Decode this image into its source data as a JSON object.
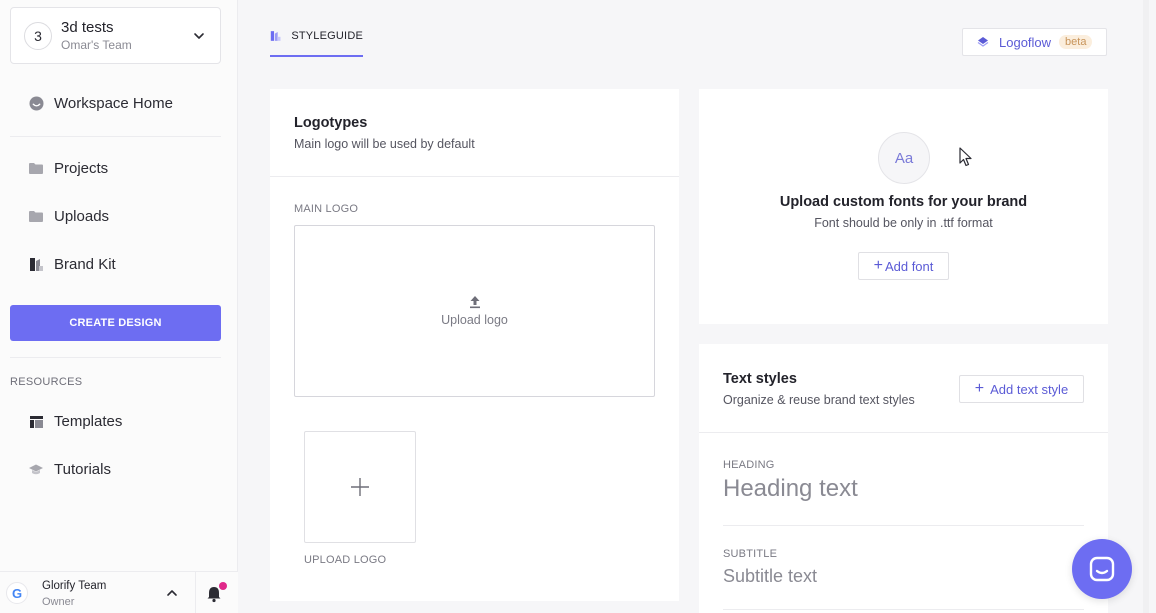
{
  "sidebar": {
    "team": {
      "avatar_letter": "3",
      "name": "3d tests",
      "subtitle": "Omar's Team"
    },
    "nav": {
      "workspace_home": "Workspace Home",
      "projects": "Projects",
      "uploads": "Uploads",
      "brand_kit": "Brand Kit"
    },
    "create_button": "CREATE DESIGN",
    "resources_label": "RESOURCES",
    "resources": {
      "templates": "Templates",
      "tutorials": "Tutorials"
    },
    "footer": {
      "logo_letter": "G",
      "name": "Glorify Team",
      "role": "Owner"
    }
  },
  "header": {
    "tab_label": "STYLEGUIDE",
    "logoflow": {
      "label": "Logoflow",
      "badge": "beta"
    }
  },
  "logotypes": {
    "title": "Logotypes",
    "subtitle": "Main logo will be used by default",
    "main_logo_label": "MAIN LOGO",
    "upload_zone_label": "Upload logo",
    "add_tile_label": "UPLOAD LOGO"
  },
  "fonts": {
    "icon_text": "Aa",
    "title": "Upload custom fonts for your brand",
    "subtitle": "Font should be only in .ttf format",
    "add_button": "Add font"
  },
  "text_styles": {
    "title": "Text styles",
    "subtitle": "Organize & reuse brand text styles",
    "add_button": "Add text style",
    "items": [
      {
        "label": "HEADING",
        "sample": "Heading text"
      },
      {
        "label": "SUBTITLE",
        "sample": "Subtitle text"
      }
    ]
  },
  "colors": {
    "accent": "#6d6df2",
    "link": "#5b5bd6",
    "notification_dot": "#e0288a",
    "beta_badge_bg": "#fbeedd"
  },
  "icons": {
    "team_switcher": "chevron-down-icon",
    "workspace_home": "smile-icon",
    "projects": "folder-icon",
    "uploads": "folder-icon",
    "brand_kit": "brand-kit-icon",
    "templates": "template-icon",
    "tutorials": "graduation-cap-icon",
    "footer_toggle": "chevron-up-icon",
    "notifications": "bell-icon",
    "styleguide_tab": "styleguide-icon",
    "logoflow": "diamond-icon",
    "upload": "upload-arrow-icon",
    "add_tile": "plus-icon",
    "font": "font-icon",
    "chat": "chat-icon"
  }
}
